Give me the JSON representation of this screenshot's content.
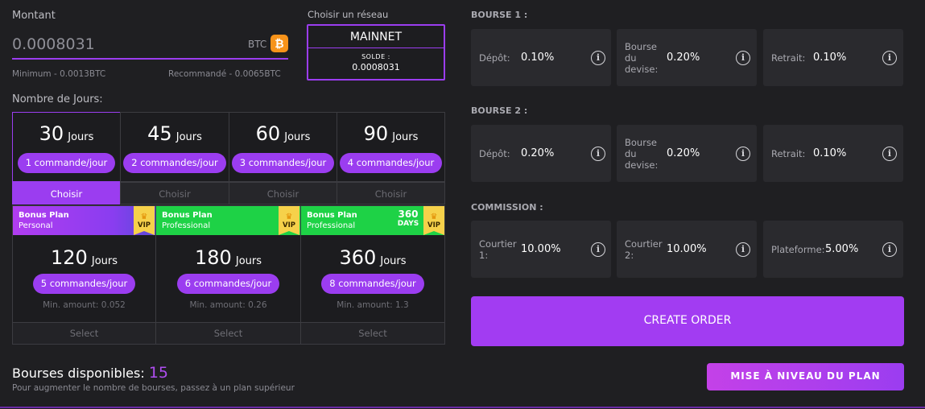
{
  "amount": {
    "label": "Montant",
    "value": "0.0008031",
    "unit": "BTC",
    "currency_icon": "bitcoin-icon",
    "minimum": "Minimum - 0.0013BTC",
    "recommended": "Recommandé - 0.0065BTC"
  },
  "network": {
    "label": "Choisir un réseau",
    "name": "MAINNET",
    "balance_label": "SOLDE :",
    "balance_value": "0.0008031"
  },
  "days": {
    "label": "Nombre de Jours:",
    "choose_label": "Choisir",
    "options": [
      {
        "number": "30",
        "unit": "Jours",
        "pill": "1 commande/jour",
        "active": true
      },
      {
        "number": "45",
        "unit": "Jours",
        "pill": "2 commandes/jour",
        "active": false
      },
      {
        "number": "60",
        "unit": "Jours",
        "pill": "3 commandes/jour",
        "active": false
      },
      {
        "number": "90",
        "unit": "Jours",
        "pill": "4 commandes/jour",
        "active": false
      }
    ]
  },
  "bonus_plans": [
    {
      "title": "Bonus Plan",
      "subtitle": "Personal",
      "vip": "VIP",
      "days_badge": "",
      "number": "120",
      "unit": "Jours",
      "pill": "5 commandes/jour",
      "min_amount": "Min. amount: 0.052",
      "select": "Select",
      "banner_color": "#9b3df0"
    },
    {
      "title": "Bonus Plan",
      "subtitle": "Professional",
      "vip": "VIP",
      "days_badge": "",
      "number": "180",
      "unit": "Jours",
      "pill": "6 commandes/jour",
      "min_amount": "Min. amount: 0.26",
      "select": "Select",
      "banner_color": "#1ed246"
    },
    {
      "title": "Bonus Plan",
      "subtitle": "Professional",
      "vip": "VIP",
      "days_badge": "360",
      "days_badge_unit": "DAYS",
      "number": "360",
      "unit": "Jours",
      "pill": "8 commandes/jour",
      "min_amount": "Min. amount: 1.3",
      "select": "Select",
      "banner_color": "#1ed246"
    }
  ],
  "exchanges": {
    "label": "Bourses disponibles:",
    "count": "15",
    "hint": "Pour augmenter le nombre de bourses, passez à un plan supérieur"
  },
  "bourse1": {
    "title": "BOURSE 1 :",
    "cards": [
      {
        "label": "Dépôt:",
        "value": "0.10%"
      },
      {
        "label": "Bourse\ndu\ndevise:",
        "value": "0.20%"
      },
      {
        "label": "Retrait:",
        "value": "0.10%"
      }
    ]
  },
  "bourse2": {
    "title": "BOURSE 2 :",
    "cards": [
      {
        "label": "Dépôt:",
        "value": "0.20%"
      },
      {
        "label": "Bourse\ndu\ndevise:",
        "value": "0.20%"
      },
      {
        "label": "Retrait:",
        "value": "0.10%"
      }
    ]
  },
  "commission": {
    "title": "COMMISSION :",
    "cards": [
      {
        "label": "Courtier\n1:",
        "value": "10.00%"
      },
      {
        "label": "Courtier\n2:",
        "value": "10.00%"
      },
      {
        "label": "Plateforme:",
        "value": "5.00%"
      }
    ]
  },
  "actions": {
    "create_order": "CREATE ORDER",
    "upgrade": "MISE À NIVEAU DU PLAN"
  },
  "colors": {
    "accent": "#9b3df0",
    "green": "#1ed246",
    "background": "#1f1f22",
    "card": "#2a2a2e"
  }
}
